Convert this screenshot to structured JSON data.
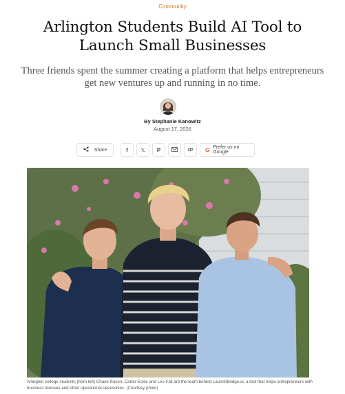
{
  "article": {
    "category": "Community",
    "headline": "Arlington Students Build AI Tool to Launch Small Businesses",
    "dek": "Three friends spent the summer creating a platform that helps entrepreneurs get new ventures up and running in no time.",
    "byline": "By Stephanie Kanowitz",
    "date": "August 17, 2026"
  },
  "share": {
    "share_label": "Share",
    "icons": [
      "facebook-icon",
      "x-icon",
      "pinterest-icon",
      "email-icon",
      "link-icon"
    ],
    "google_label": "Prefer us on Google"
  },
  "photo": {
    "caption": "Arlington college students (from left) Chase Rosen, Carter Eckle and Leo Fall are the team behind LaunchBridge.ai, a tool that helps entrepreneurs with business licenses and other operational necessities. (Courtesy photo)"
  },
  "colors": {
    "accent": "#d9731f",
    "headline": "#111111",
    "dek": "#555555"
  }
}
